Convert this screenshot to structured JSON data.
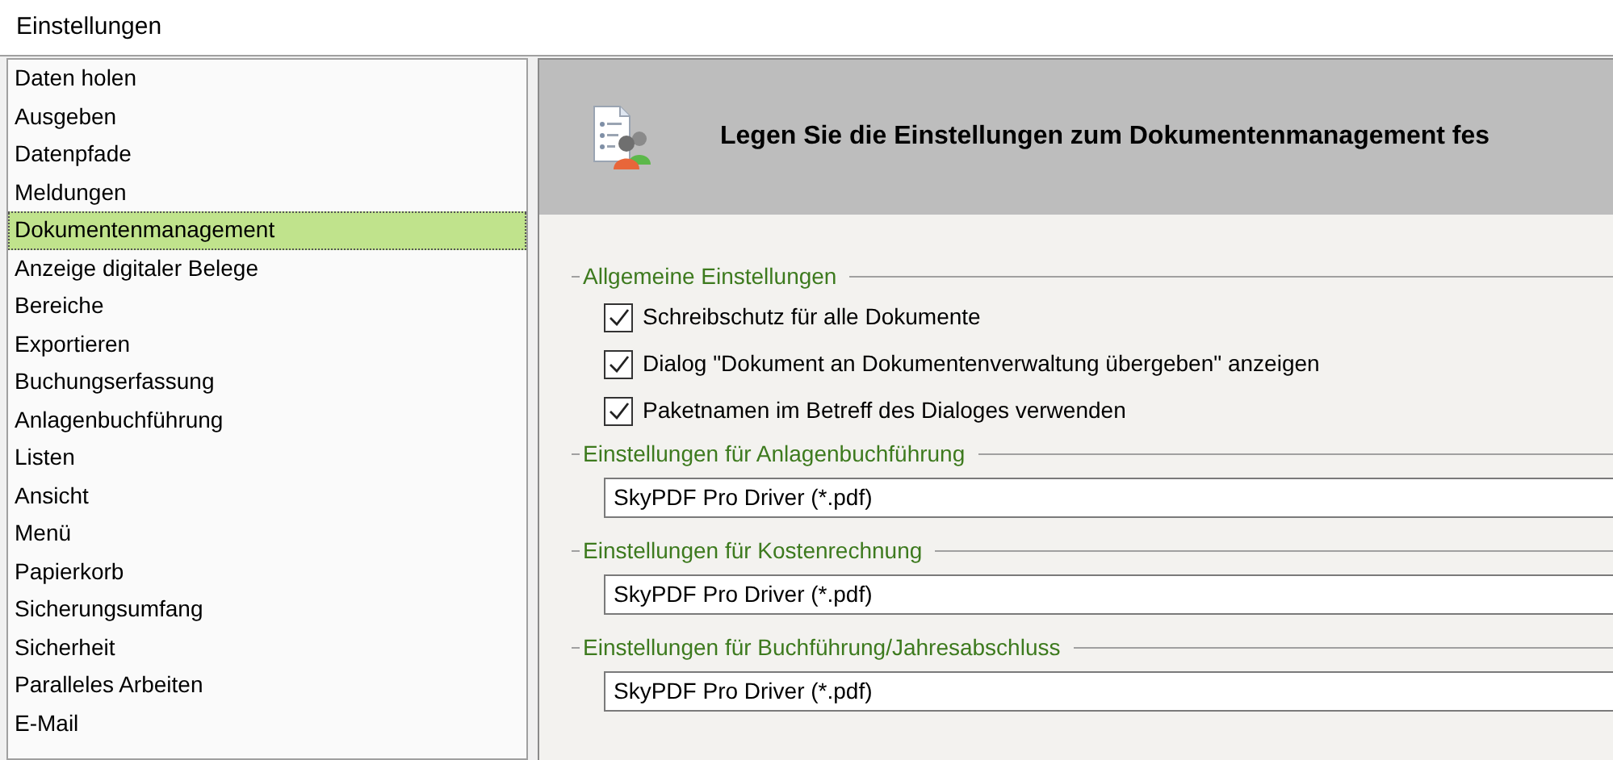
{
  "window": {
    "title": "Einstellungen"
  },
  "sidebar": {
    "items": [
      {
        "label": "Daten holen",
        "selected": false
      },
      {
        "label": "Ausgeben",
        "selected": false
      },
      {
        "label": "Datenpfade",
        "selected": false
      },
      {
        "label": "Meldungen",
        "selected": false
      },
      {
        "label": "Dokumentenmanagement",
        "selected": true
      },
      {
        "label": "Anzeige digitaler Belege",
        "selected": false
      },
      {
        "label": "Bereiche",
        "selected": false
      },
      {
        "label": "Exportieren",
        "selected": false
      },
      {
        "label": "Buchungserfassung",
        "selected": false
      },
      {
        "label": "Anlagenbuchführung",
        "selected": false
      },
      {
        "label": "Listen",
        "selected": false
      },
      {
        "label": "Ansicht",
        "selected": false
      },
      {
        "label": "Menü",
        "selected": false
      },
      {
        "label": "Papierkorb",
        "selected": false
      },
      {
        "label": "Sicherungsumfang",
        "selected": false
      },
      {
        "label": "Sicherheit",
        "selected": false
      },
      {
        "label": "Paralleles Arbeiten",
        "selected": false
      },
      {
        "label": "E-Mail",
        "selected": false
      }
    ]
  },
  "header": {
    "title": "Legen Sie die Einstellungen zum Dokumentenmanagement fes"
  },
  "groups": [
    {
      "title": "Allgemeine Einstellungen",
      "kind": "checkboxes",
      "options": [
        {
          "label": "Schreibschutz für alle Dokumente",
          "checked": true
        },
        {
          "label": "Dialog \"Dokument an Dokumentenverwaltung übergeben\" anzeigen",
          "checked": true
        },
        {
          "label": "Paketnamen im Betreff des Dialoges verwenden",
          "checked": true
        }
      ]
    },
    {
      "title": "Einstellungen für Anlagenbuchführung",
      "kind": "field",
      "value": "SkyPDF Pro Driver (*.pdf)"
    },
    {
      "title": "Einstellungen für Kostenrechnung",
      "kind": "field",
      "value": "SkyPDF Pro Driver (*.pdf)"
    },
    {
      "title": "Einstellungen für Buchführung/Jahresabschluss",
      "kind": "field",
      "value": "SkyPDF Pro Driver (*.pdf)"
    }
  ]
}
